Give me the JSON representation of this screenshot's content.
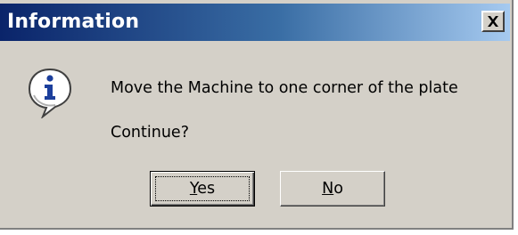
{
  "window": {
    "title": "Information",
    "close_glyph": "✕"
  },
  "message": {
    "line1": "Move the Machine to one corner of the plate",
    "line2": "Continue?"
  },
  "buttons": {
    "yes": {
      "mnemonic": "Y",
      "rest": "es"
    },
    "no": {
      "mnemonic": "N",
      "rest": "o"
    }
  },
  "icons": {
    "info": "information-icon",
    "close": "close-icon"
  },
  "colors": {
    "dialog_face": "#d4d0c8",
    "title_start": "#0a246a",
    "title_end": "#a6caf0",
    "info_icon_letter": "#1c3f9c"
  }
}
